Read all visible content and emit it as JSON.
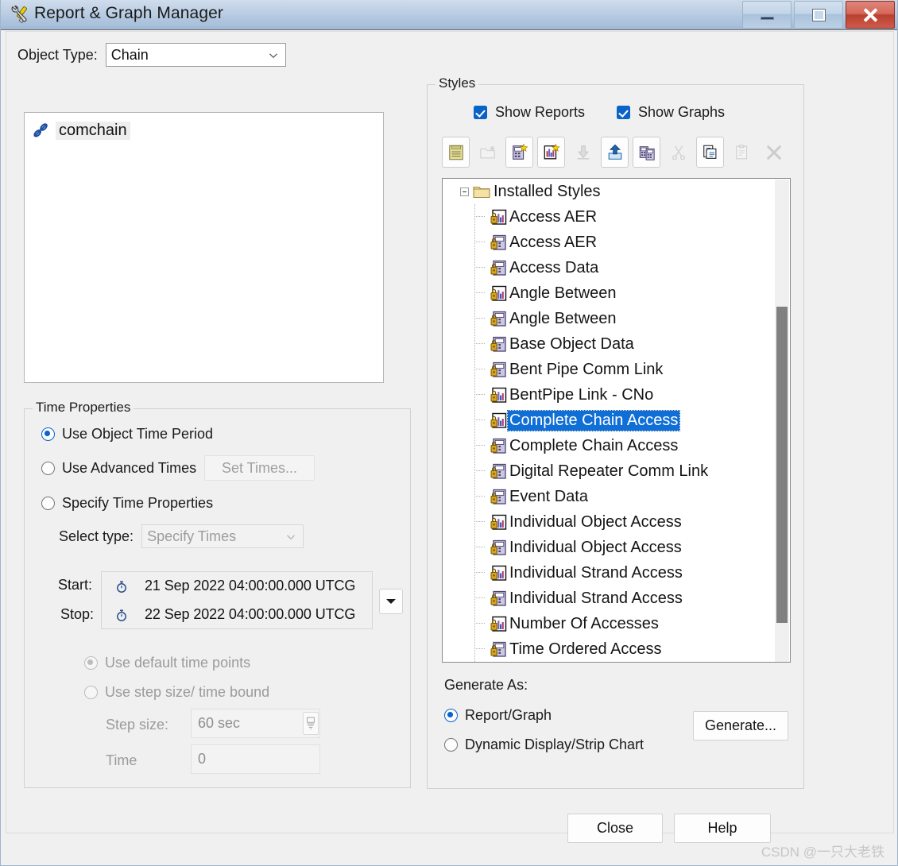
{
  "window": {
    "title": "Report & Graph Manager",
    "icon": "tools-icon",
    "buttons": {
      "minimize": "minimize-button",
      "maximize": "maximize-button",
      "close": "close-button"
    }
  },
  "object_type": {
    "label": "Object Type:",
    "value": "Chain"
  },
  "object_list": {
    "items": [
      {
        "name": "comchain",
        "icon": "chain-icon",
        "selected": true
      }
    ]
  },
  "time_properties": {
    "title": "Time Properties",
    "options": [
      {
        "label": "Use Object Time Period",
        "checked": true,
        "disabled": false
      },
      {
        "label": "Use Advanced Times",
        "checked": false,
        "disabled": false
      },
      {
        "label": "Specify Time Properties",
        "checked": false,
        "disabled": false
      }
    ],
    "set_times_button": "Set Times...",
    "select_type_label": "Select type:",
    "select_type_value": "Specify Times",
    "start_label": "Start:",
    "start_value": "21 Sep 2022 04:00:00.000 UTCG",
    "stop_label": "Stop:",
    "stop_value": "22 Sep 2022 04:00:00.000 UTCG",
    "time_point_options": [
      {
        "label": "Use default time points",
        "checked": true,
        "disabled": true
      },
      {
        "label": "Use step size/ time bound",
        "checked": false,
        "disabled": true
      }
    ],
    "step_size_label": "Step size:",
    "step_size_value": "60 sec",
    "time_label": "Time",
    "time_value": "0"
  },
  "styles": {
    "title": "Styles",
    "show_reports": {
      "label": "Show Reports",
      "checked": true
    },
    "show_graphs": {
      "label": "Show Graphs",
      "checked": true
    },
    "toolbar": [
      {
        "name": "new-report-style",
        "icon": "report-new-icon",
        "enabled": true
      },
      {
        "name": "open-folder-style",
        "icon": "folder-open-icon",
        "enabled": false
      },
      {
        "name": "new-report",
        "icon": "report-star-icon",
        "enabled": true
      },
      {
        "name": "new-graph",
        "icon": "graph-star-icon",
        "enabled": true
      },
      {
        "name": "import-style",
        "icon": "download-arrow-icon",
        "enabled": false
      },
      {
        "name": "export-style",
        "icon": "upload-arrow-icon",
        "enabled": true
      },
      {
        "name": "duplicate-style",
        "icon": "duplicate-icon",
        "enabled": true
      },
      {
        "name": "cut-style",
        "icon": "scissors-icon",
        "enabled": false
      },
      {
        "name": "copy-style",
        "icon": "copy-icon",
        "enabled": true
      },
      {
        "name": "paste-style",
        "icon": "clipboard-icon",
        "enabled": false
      },
      {
        "name": "delete-style",
        "icon": "delete-x-icon",
        "enabled": false
      }
    ],
    "tree": {
      "root": {
        "label": "Installed Styles",
        "icon": "folder-icon",
        "expanded": true
      },
      "items": [
        {
          "label": "Access AER",
          "icon": "graph-lock-icon",
          "selected": false
        },
        {
          "label": "Access AER",
          "icon": "report-lock-icon",
          "selected": false
        },
        {
          "label": "Access Data",
          "icon": "report-lock-icon",
          "selected": false
        },
        {
          "label": "Angle Between",
          "icon": "graph-lock-icon",
          "selected": false
        },
        {
          "label": "Angle Between",
          "icon": "report-lock-icon",
          "selected": false
        },
        {
          "label": "Base Object Data",
          "icon": "report-lock-icon",
          "selected": false
        },
        {
          "label": "Bent Pipe Comm Link",
          "icon": "report-lock-icon",
          "selected": false
        },
        {
          "label": "BentPipe Link - CNo",
          "icon": "graph-lock-icon",
          "selected": false
        },
        {
          "label": "Complete Chain Access",
          "icon": "graph-lock-icon",
          "selected": true
        },
        {
          "label": "Complete Chain Access",
          "icon": "report-lock-icon",
          "selected": false
        },
        {
          "label": "Digital Repeater Comm Link",
          "icon": "report-lock-icon",
          "selected": false
        },
        {
          "label": "Event Data",
          "icon": "report-lock-icon",
          "selected": false
        },
        {
          "label": "Individual Object Access",
          "icon": "graph-lock-icon",
          "selected": false
        },
        {
          "label": "Individual Object Access",
          "icon": "report-lock-icon",
          "selected": false
        },
        {
          "label": "Individual Strand Access",
          "icon": "graph-lock-icon",
          "selected": false
        },
        {
          "label": "Individual Strand Access",
          "icon": "report-lock-icon",
          "selected": false
        },
        {
          "label": "Number Of Accesses",
          "icon": "graph-lock-icon",
          "selected": false
        },
        {
          "label": "Time Ordered Access",
          "icon": "report-lock-icon",
          "selected": false
        }
      ]
    }
  },
  "generate_as": {
    "title": "Generate As:",
    "options": [
      {
        "label": "Report/Graph",
        "checked": true
      },
      {
        "label": "Dynamic Display/Strip Chart",
        "checked": false
      }
    ],
    "button": "Generate..."
  },
  "footer": {
    "close": "Close",
    "help": "Help"
  },
  "watermark": "CSDN @一只大老铁",
  "colors": {
    "accent": "#0a64c8",
    "selection": "#0f6fd6",
    "titlebar_top": "#cfdcec",
    "titlebar_bottom": "#9eb8d4",
    "close_button": "#b9402f"
  }
}
